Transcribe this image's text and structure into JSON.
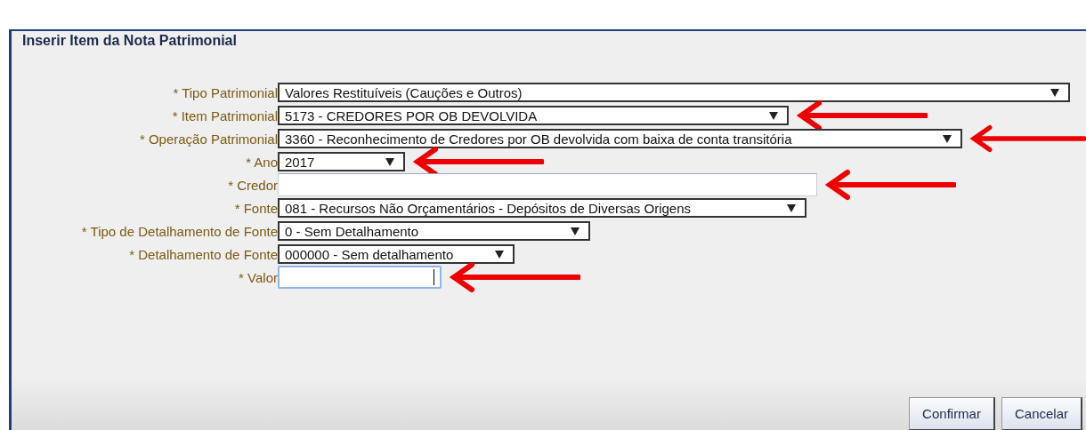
{
  "dialog": {
    "title": "Inserir Item da Nota Patrimonial"
  },
  "fields": [
    {
      "kind": "select",
      "label": "* Tipo Patrimonial",
      "value": "Valores Restituíveis (Cauções e Outros)",
      "arrowed": false
    },
    {
      "kind": "select",
      "label": "* Item Patrimonial",
      "value": "5173 - CREDORES POR OB DEVOLVIDA",
      "arrowed": true
    },
    {
      "kind": "select",
      "label": "* Operação Patrimonial",
      "value": "3360 - Reconhecimento de Credores por OB devolvida com baixa de conta transitória",
      "arrowed": true
    },
    {
      "kind": "select",
      "label": "* Ano",
      "value": "2017",
      "arrowed": true
    },
    {
      "kind": "text",
      "label": "* Credor",
      "focused": false,
      "arrowed": true
    },
    {
      "kind": "select",
      "label": "* Fonte",
      "value": "081 - Recursos Não Orçamentários - Depósitos de Diversas Origens",
      "arrowed": false
    },
    {
      "kind": "select",
      "label": "* Tipo de Detalhamento de Fonte",
      "value": "0 - Sem Detalhamento",
      "arrowed": false
    },
    {
      "kind": "select",
      "label": "* Detalhamento de Fonte",
      "value": "000000 - Sem detalhamento",
      "arrowed": false
    },
    {
      "kind": "text",
      "label": "* Valor",
      "focused": true,
      "arrowed": true
    }
  ],
  "buttons": [
    "Confirmar",
    "Cancelar"
  ]
}
